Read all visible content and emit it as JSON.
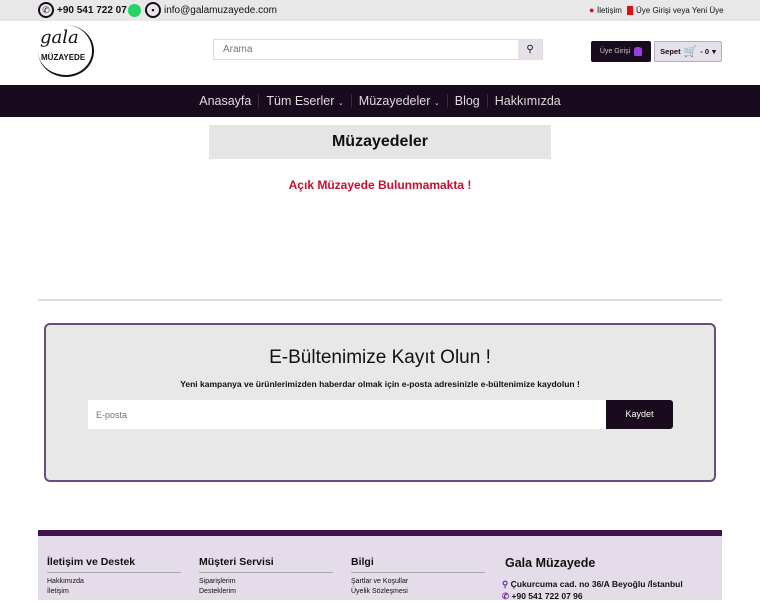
{
  "topbar": {
    "phone": "+90 541 722 07 96",
    "email": "info@galamuzayede.com",
    "contact": "İletişim",
    "login": "Üye Girişi veya Yeni Üye"
  },
  "header": {
    "logo_text": "gala MÜZAYEDE",
    "search_placeholder": "Arama",
    "login_button": "Üye Girişi",
    "cart_label": "Sepet",
    "cart_count": "- 0"
  },
  "nav": [
    {
      "label": "Anasayfa"
    },
    {
      "label": "Tüm Eserler",
      "dropdown": true
    },
    {
      "label": "Müzayedeler",
      "dropdown": true
    },
    {
      "label": "Blog"
    },
    {
      "label": "Hakkımızda"
    }
  ],
  "main": {
    "title": "Müzayedeler",
    "message": "Açık Müzayede Bulunmamakta !"
  },
  "newsletter": {
    "title": "E-Bültenimize Kayıt Olun !",
    "subtitle": "Yeni kampanya ve ürünlerimizden haberdar olmak için e-posta adresinizle e-bültenimize kaydolun !",
    "placeholder": "E-posta",
    "button": "Kaydet"
  },
  "footer": {
    "columns": [
      {
        "title": "İletişim ve Destek",
        "links": [
          "Hakkımızda",
          "İletişim"
        ]
      },
      {
        "title": "Müşteri Servisi",
        "links": [
          "Siparişlerim",
          "Desteklerim"
        ]
      },
      {
        "title": "Bilgi",
        "links": [
          "Şartlar ve Koşullar",
          "Üyelik Sözleşmesi"
        ]
      }
    ],
    "company": "Gala Müzayede",
    "address": "Çukurcuma cad. no 36/A Beyoğlu /İstanbul",
    "phone": "+90 541 722 07 96"
  },
  "colors": {
    "dark": "#1a0a1e",
    "red": "#c8102e",
    "purple": "#3d1450"
  }
}
